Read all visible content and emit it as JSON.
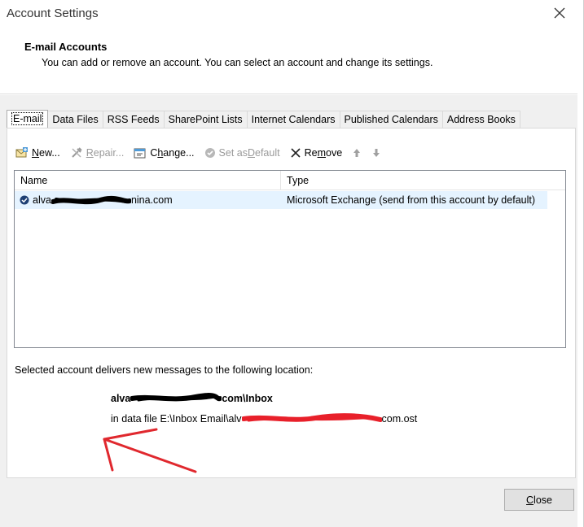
{
  "window": {
    "title": "Account Settings"
  },
  "header": {
    "title": "E-mail Accounts",
    "subtitle": "You can add or remove an account. You can select an account and change its settings."
  },
  "tabs": [
    {
      "label": "E-mail",
      "active": true
    },
    {
      "label": "Data Files"
    },
    {
      "label": "RSS Feeds"
    },
    {
      "label": "SharePoint Lists"
    },
    {
      "label": "Internet Calendars"
    },
    {
      "label": "Published Calendars"
    },
    {
      "label": "Address Books"
    }
  ],
  "toolbar": {
    "new": {
      "u": "N",
      "rest": "ew..."
    },
    "repair": {
      "u": "R",
      "rest": "epair..."
    },
    "change": {
      "pre": "C",
      "u": "h",
      "rest": "ange..."
    },
    "set_default": {
      "pre": "Set as ",
      "u": "D",
      "rest": "efault"
    },
    "remove": {
      "pre": "Re",
      "u": "m",
      "rest": "ove"
    }
  },
  "accounts_list": {
    "columns": [
      "Name",
      "Type"
    ],
    "rows": [
      {
        "name_start": "alva",
        "name_end": "nina.com",
        "type": "Microsoft Exchange (send from this account by default)"
      }
    ]
  },
  "delivery": {
    "label": "Selected account delivers new messages to the following location:",
    "location_start": "alva",
    "location_end": "com\\Inbox",
    "data_file_start": "in data file E:\\Inbox Email\\alv",
    "data_file_end": "com.ost"
  },
  "footer": {
    "close": {
      "u": "C",
      "rest": "lose"
    }
  },
  "colors": {
    "selection": "#e5f3ff",
    "redaction_black": "#000000",
    "redaction_red": "#e8202a",
    "arrow_red": "#e0282e"
  }
}
